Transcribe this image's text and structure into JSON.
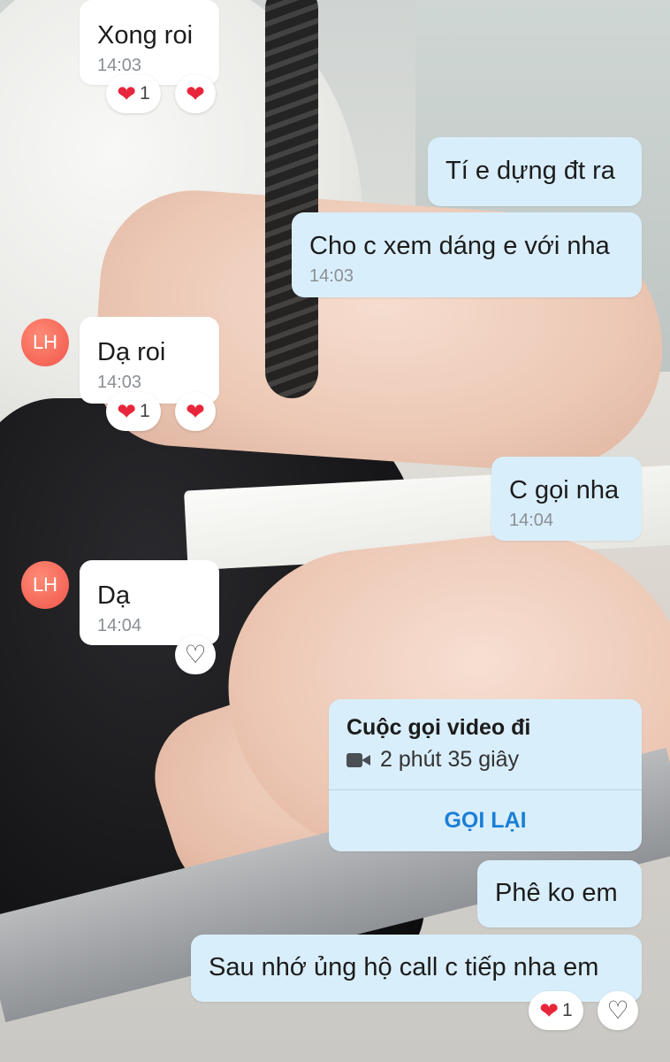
{
  "messages": [
    {
      "id": "m1",
      "side": "incoming",
      "text": "Xong roi",
      "time": "14:03"
    },
    {
      "id": "m2",
      "side": "outgoing",
      "text": "Tí e dựng đt ra"
    },
    {
      "id": "m3",
      "side": "outgoing",
      "text": "Cho c xem dáng e với nha",
      "time": "14:03"
    },
    {
      "id": "m4",
      "side": "incoming",
      "avatar": "LH",
      "text": "Dạ roi",
      "time": "14:03"
    },
    {
      "id": "m5",
      "side": "outgoing",
      "text": "C gọi nha",
      "time": "14:04"
    },
    {
      "id": "m6",
      "side": "incoming",
      "avatar": "LH",
      "text": "Dạ",
      "time": "14:04"
    },
    {
      "id": "m7",
      "side": "outgoing",
      "text": "Phê ko em"
    },
    {
      "id": "m8",
      "side": "outgoing",
      "text": "Sau nhớ ủng hộ call c tiếp nha em"
    }
  ],
  "reactions": {
    "m1": {
      "count": "1"
    },
    "m4": {
      "count": "1"
    },
    "m8": {
      "count": "1"
    }
  },
  "call": {
    "title": "Cuộc gọi video đi",
    "duration": "2 phút 35 giây",
    "action": "GỌI LẠI"
  },
  "icons": {
    "heart_filled": "heart-icon",
    "heart_outline": "heart-outline-icon",
    "video_camera": "video-camera-icon"
  },
  "colors": {
    "incoming_bubble": "#ffffff",
    "outgoing_bubble": "#d9eefb",
    "heart": "#e8263b",
    "avatar": "#f0574a",
    "call_action": "#1a7fd6"
  }
}
